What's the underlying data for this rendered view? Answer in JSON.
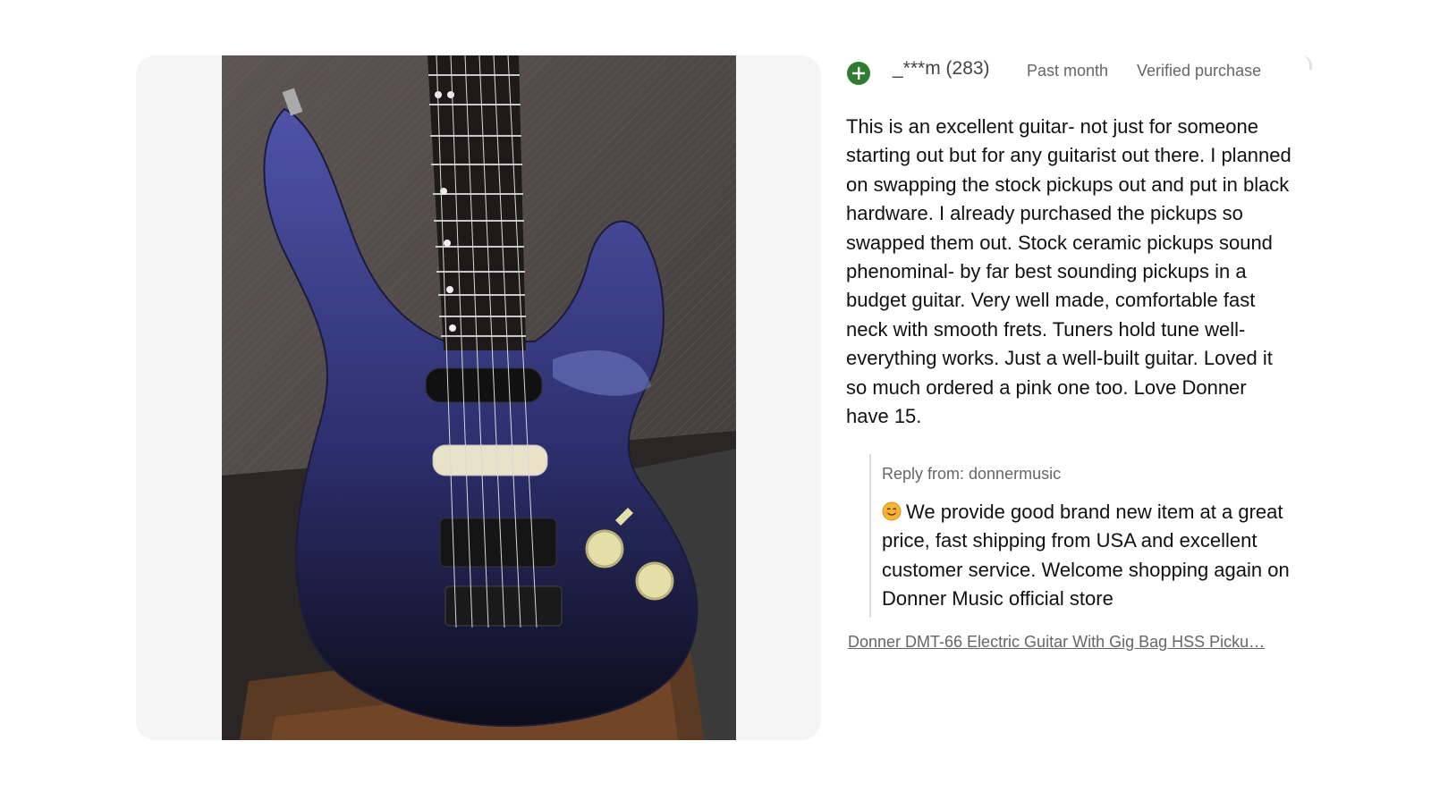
{
  "review": {
    "avatar_icon": "plus-circle-icon",
    "avatar_color": "#2e7d32",
    "username": "_***m (283)",
    "date": "Past month",
    "verified_label": "Verified purchase",
    "body": "This is an excellent guitar- not just for someone starting out but for any guitarist out there. I planned on swapping the stock pickups out and put in black hardware. I already purchased the pickups so swapped them out. Stock ceramic pickups sound phenominal- by far best sounding pickups in a budget guitar. Very well made, comfortable fast neck with smooth frets. Tuners hold tune well- everything works. Just a well-built guitar. Loved it so much ordered a pink one too. Love Donner have 15."
  },
  "reply": {
    "from": "Reply from: donnermusic",
    "emoji_icon": "smiling-face-emoji-icon",
    "text": "We provide good brand new item at a great price, fast shipping from USA and excellent customer service. Welcome shopping again on Donner Music official store"
  },
  "product_link": {
    "label": "Donner DMT-66 Electric Guitar With Gig Bag HSS Picku…"
  },
  "photo": {
    "subject": "guitar-photo-icon",
    "guitar_color": "#3d3f8a"
  }
}
